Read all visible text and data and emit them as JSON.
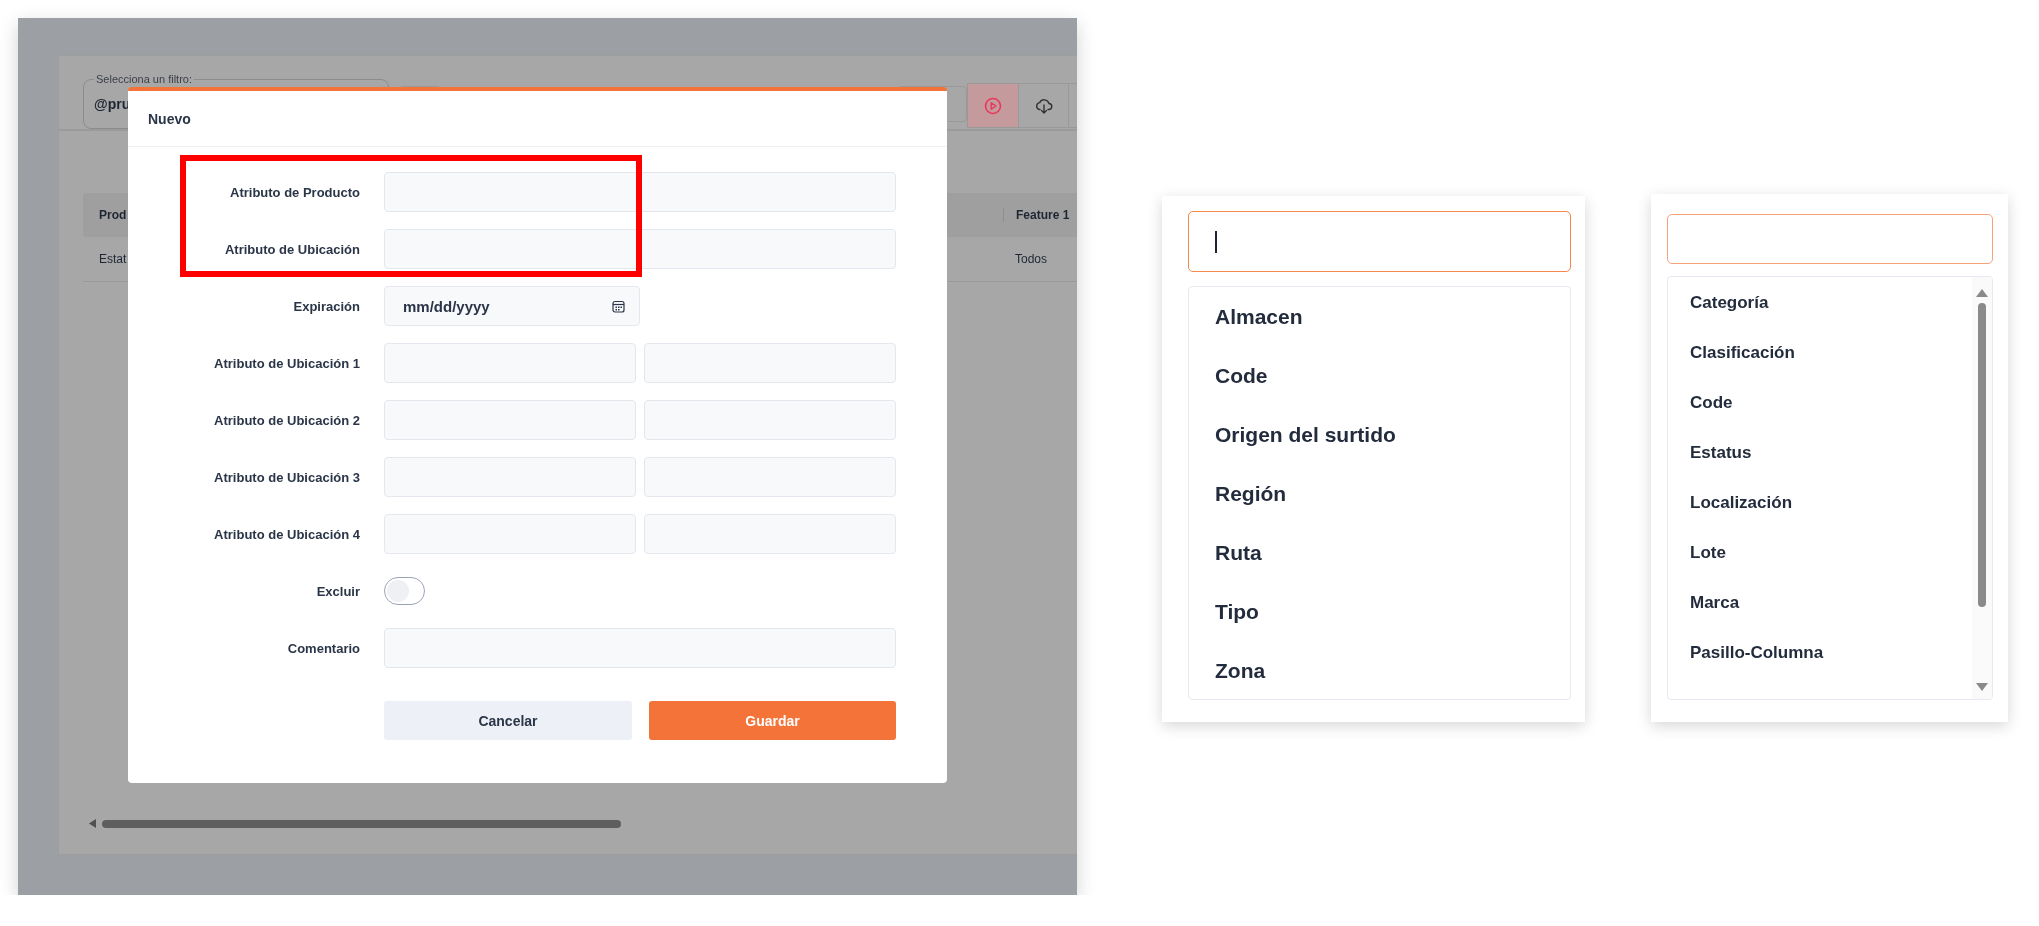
{
  "background_page": {
    "filter": {
      "label": "Selecciona un filtro:",
      "value": "@pru"
    },
    "table": {
      "columns": [
        "Prod",
        "Feature 1"
      ],
      "rows": [
        [
          "Estat",
          "Todos"
        ]
      ]
    }
  },
  "dialog": {
    "title": "Nuevo",
    "fields": [
      {
        "label": "Atributo de Producto",
        "kind": "text",
        "highlighted": true
      },
      {
        "label": "Atributo de Ubicación",
        "kind": "text",
        "highlighted": true
      },
      {
        "label": "Expiración",
        "kind": "date",
        "placeholder": "mm/dd/yyyy",
        "highlighted": false
      },
      {
        "label": "Atributo de Ubicación 1",
        "kind": "pair",
        "highlighted": false
      },
      {
        "label": "Atributo de Ubicación 2",
        "kind": "pair",
        "highlighted": false
      },
      {
        "label": "Atributo de Ubicación 3",
        "kind": "pair",
        "highlighted": false
      },
      {
        "label": "Atributo de Ubicación 4",
        "kind": "pair",
        "highlighted": false
      },
      {
        "label": "Excluir",
        "kind": "toggle",
        "on": false,
        "highlighted": false
      },
      {
        "label": "Comentario",
        "kind": "text",
        "highlighted": false
      }
    ],
    "buttons": [
      {
        "label": "Cancelar",
        "kind": "secondary"
      },
      {
        "label": "Guardar",
        "kind": "primary"
      }
    ]
  },
  "dropdowns": [
    {
      "focused": true,
      "scrollable": false,
      "options": [
        "Almacen",
        "Code",
        "Origen del surtido",
        "Región",
        "Ruta",
        "Tipo",
        "Zona"
      ]
    },
    {
      "focused": false,
      "scrollable": true,
      "options": [
        "Categoría",
        "Clasificación",
        "Code",
        "Estatus",
        "Localización",
        "Lote",
        "Marca",
        "Pasillo-Columna"
      ]
    }
  ]
}
